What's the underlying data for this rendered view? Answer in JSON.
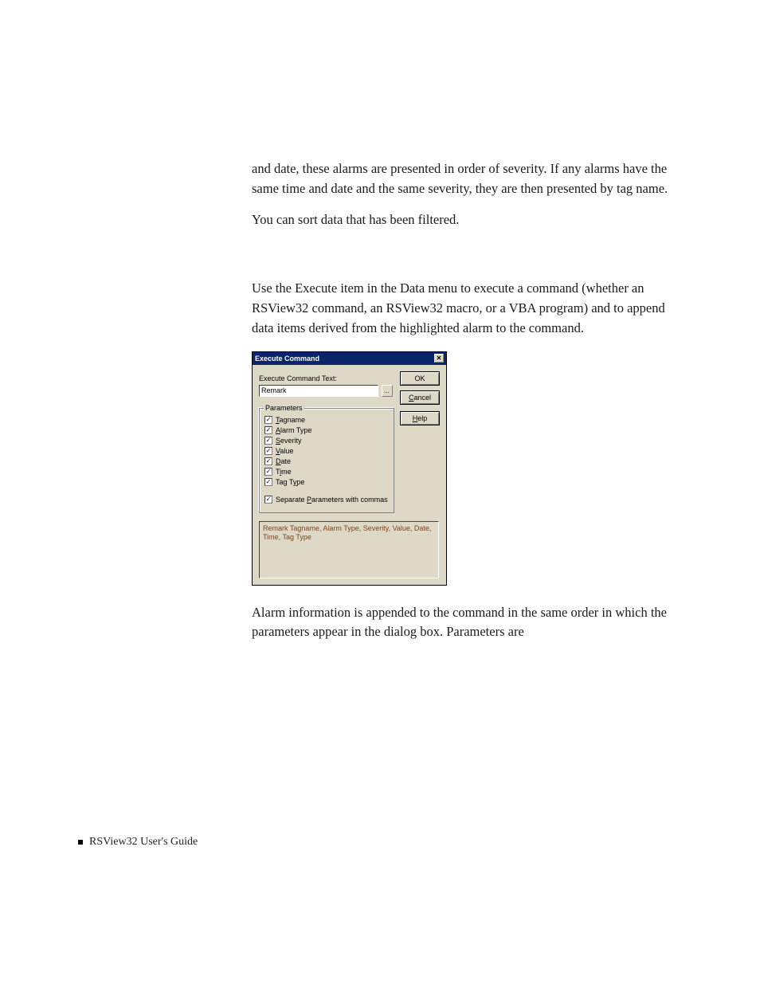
{
  "body": {
    "para1": "and date, these alarms are presented in order of severity. If any alarms have the same time and date and the same severity, they are then presented by tag name.",
    "para2": "You can sort data that has been filtered.",
    "para3": "Use the Execute item in the Data menu to execute a command (whether an RSView32 command, an RSView32 macro, or a VBA program) and to append data items derived from the highlighted alarm to the command.",
    "para4": "Alarm information is appended to the command in the same order in which the parameters appear in the dialog box. Parameters are"
  },
  "dialog": {
    "title": "Execute Command",
    "cmd_label": "Execute Command Text:",
    "cmd_value": "Remark",
    "browse": "...",
    "ok": "OK",
    "cancel": "Cancel",
    "help": "Help",
    "fieldset_legend": "Parameters",
    "params": {
      "tagname": "Tagname",
      "alarmtype": "Alarm Type",
      "severity": "Severity",
      "value": "Value",
      "date": "Date",
      "time": "Time",
      "tagtype": "Tag Type",
      "separate": "Separate Parameters with commas"
    },
    "preview": "Remark Tagname, Alarm Type, Severity, Value, Date, Time, Tag Type"
  },
  "footer": {
    "text": "RSView32  User's Guide"
  }
}
